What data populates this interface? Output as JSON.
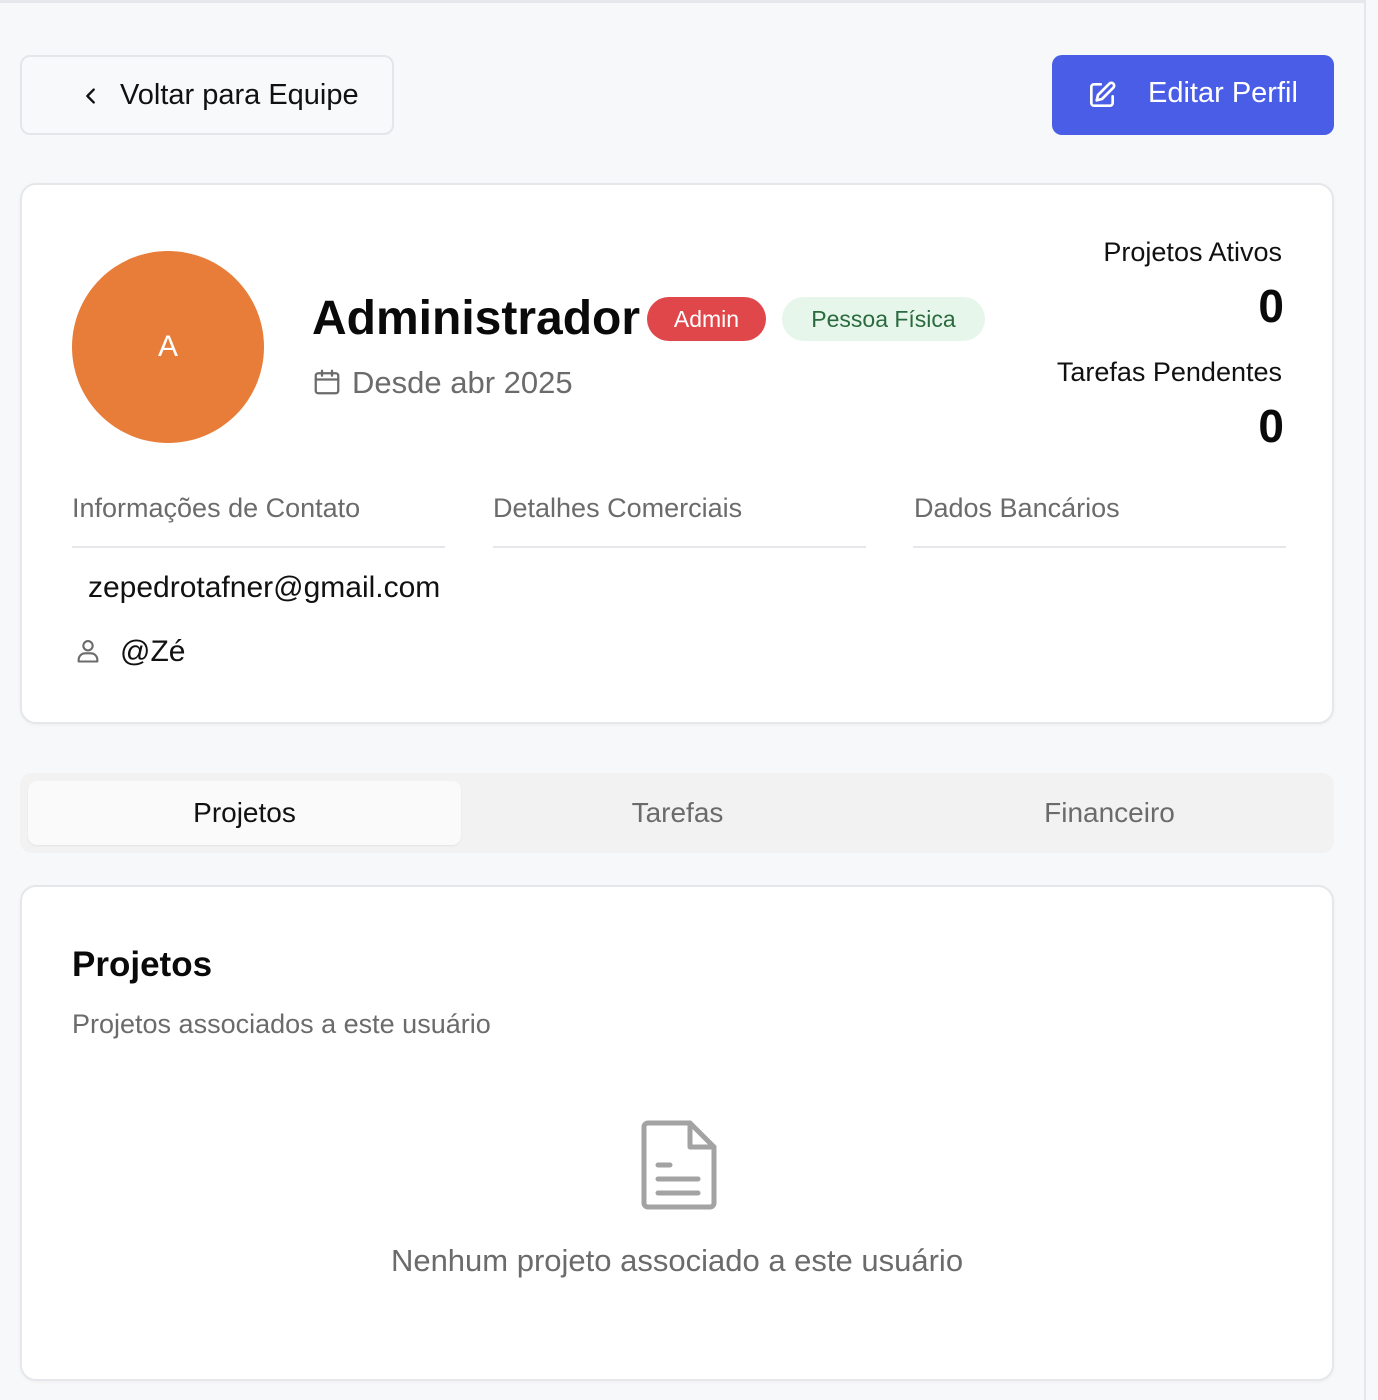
{
  "header": {
    "back_label": "Voltar para Equipe",
    "edit_label": "Editar Perfil"
  },
  "profile": {
    "avatar_initial": "A",
    "name": "Administrador",
    "role_badge": "Admin",
    "type_badge": "Pessoa Física",
    "since": "Desde abr 2025",
    "stats": {
      "active_projects_label": "Projetos Ativos",
      "active_projects_value": "0",
      "pending_tasks_label": "Tarefas Pendentes",
      "pending_tasks_value": "0"
    },
    "sections": {
      "contact": "Informações de Contato",
      "commercial": "Detalhes Comerciais",
      "bank": "Dados Bancários"
    },
    "email": "zepedrotafner@gmail.com",
    "handle": "@Zé"
  },
  "tabs": [
    {
      "label": "Projetos",
      "active": true
    },
    {
      "label": "Tarefas",
      "active": false
    },
    {
      "label": "Financeiro",
      "active": false
    }
  ],
  "projects_panel": {
    "title": "Projetos",
    "subtitle": "Projetos associados a este usuário",
    "empty_message": "Nenhum projeto associado a este usuário"
  },
  "colors": {
    "primary": "#4a5de6",
    "avatar": "#e77d38",
    "admin_badge": "#e0474a",
    "type_badge_bg": "#e6f6ea",
    "type_badge_text": "#2b6a3e"
  },
  "icons": {
    "back": "chevron-left-icon",
    "edit": "edit-square-icon",
    "since": "calendar-icon",
    "handle": "user-icon",
    "empty": "document-icon"
  }
}
